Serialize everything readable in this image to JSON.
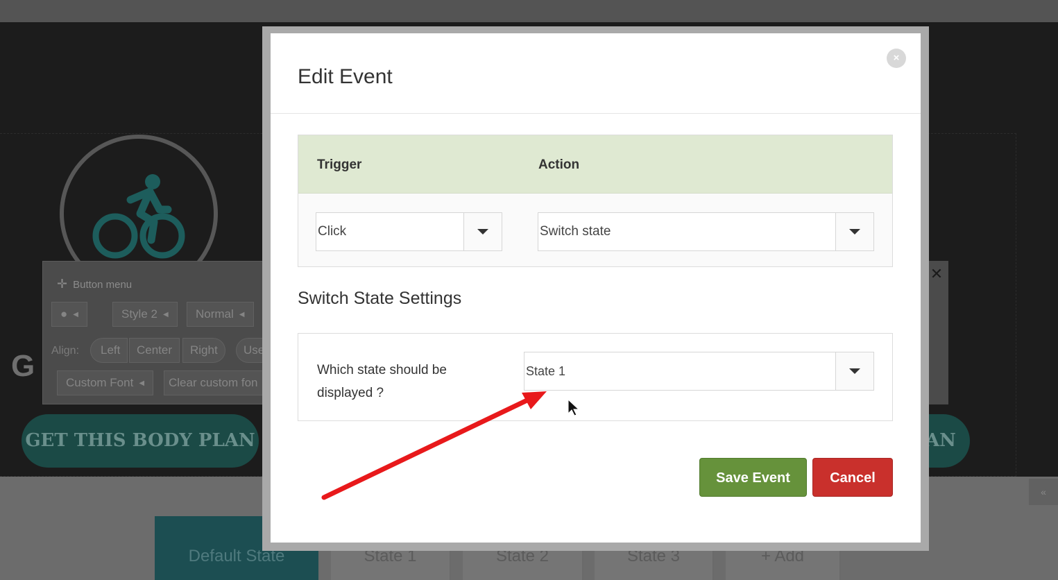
{
  "background": {
    "button_menu": {
      "title": "Button menu",
      "palette_icon": "palette-icon",
      "style_label": "Style 2",
      "size_label": "Normal",
      "align_label": "Align:",
      "align_options": [
        "Left",
        "Center",
        "Right"
      ],
      "use_label": "Use",
      "custom_font_label": "Custom Font",
      "clear_font_label": "Clear custom fon"
    },
    "heading_fragment": "G",
    "cta_left": "GET THIS BODY PLAN",
    "cta_right_fragment": "AN",
    "state_tabs": [
      "Default State",
      "State 1",
      "State 2",
      "State 3",
      "+ Add"
    ]
  },
  "modal": {
    "title": "Edit Event",
    "close_icon": "close-icon",
    "trigger_label": "Trigger",
    "action_label": "Action",
    "trigger_value": "Click",
    "action_value": "Switch state",
    "settings_title": "Switch State Settings",
    "state_question": "Which state should be displayed ?",
    "state_value": "State 1",
    "save_label": "Save Event",
    "cancel_label": "Cancel"
  },
  "colors": {
    "save": "#66923b",
    "cancel": "#c9302c",
    "header_green": "#dfe9d2",
    "annotation_arrow": "#e8191b"
  }
}
